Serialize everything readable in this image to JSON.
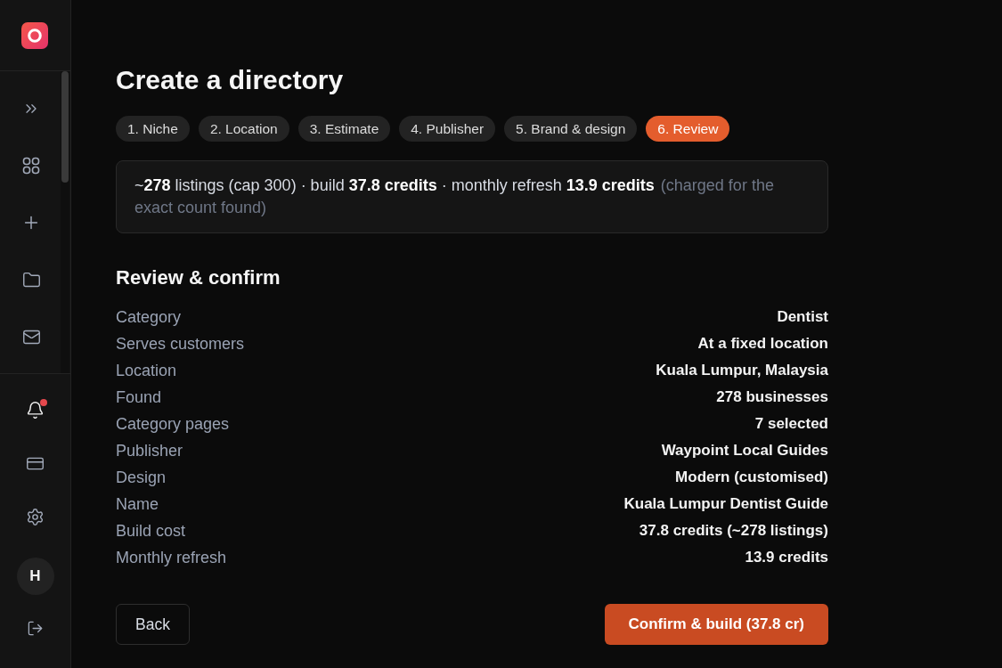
{
  "sidebar": {
    "notifications_unread": true,
    "user_initial": "H"
  },
  "page": {
    "title": "Create a directory"
  },
  "steps": [
    {
      "label": "1. Niche",
      "selected": false
    },
    {
      "label": "2. Location",
      "selected": false
    },
    {
      "label": "3. Estimate",
      "selected": false
    },
    {
      "label": "4. Publisher",
      "selected": false
    },
    {
      "label": "5. Brand & design",
      "selected": false
    },
    {
      "label": "6. Review",
      "selected": true
    }
  ],
  "summary": {
    "text": "~**278** listings (cap 300) · build **37.8 credits** · monthly refresh **13.9 credits**",
    "note": "(charged for the exact count found)"
  },
  "review": {
    "heading": "Review & confirm",
    "rows": [
      {
        "label": "Category",
        "value": "Dentist"
      },
      {
        "label": "Serves customers",
        "value": "At a fixed location"
      },
      {
        "label": "Location",
        "value": "Kuala Lumpur, Malaysia"
      },
      {
        "label": "Found",
        "value": "278 businesses"
      },
      {
        "label": "Category pages",
        "value": "7 selected"
      },
      {
        "label": "Publisher",
        "value": "Waypoint Local Guides"
      },
      {
        "label": "Design",
        "value": "Modern (customised)"
      },
      {
        "label": "Name",
        "value": "Kuala Lumpur Dentist Guide"
      },
      {
        "label": "Build cost",
        "value": "37.8 credits (~278 listings)"
      },
      {
        "label": "Monthly refresh",
        "value": "13.9 credits"
      }
    ]
  },
  "actions": {
    "back": "Back",
    "confirm": "Confirm & build (37.8 cr)"
  }
}
